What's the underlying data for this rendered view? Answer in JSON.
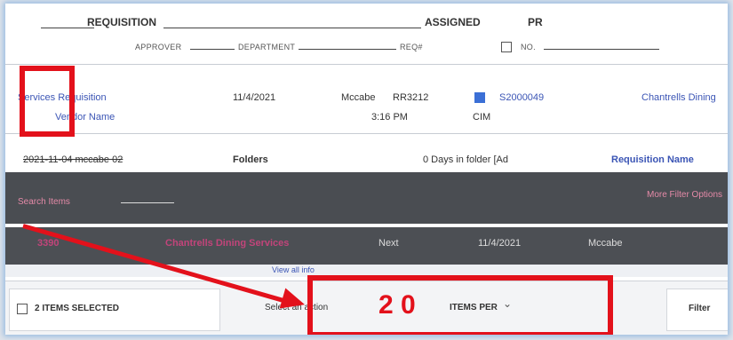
{
  "header": {
    "col_requisition": "REQUISITION",
    "col_assigned": "ASSIGNED",
    "col_pr": "PR",
    "sub_cols": [
      "APPROVER",
      "DEPARTMENT",
      "REQ#",
      "NO."
    ]
  },
  "rows": [
    {
      "name": "Services Requisition",
      "date": "11/4/2021",
      "user": "Mccabe",
      "pr_number": "RR3212",
      "vendor": "Vendor Name",
      "time": "3:16 PM",
      "amount": "S2000049",
      "status": "CIM",
      "org": "Chantrells Dining"
    },
    {
      "name": "2021-11-04 mccabe 02",
      "folder": "Folders",
      "days": "0 Days in folder [Ad",
      "req_name": "Requisition Name"
    }
  ],
  "band": {
    "left_text": "Search Items",
    "right_text": "More Filter Options"
  },
  "dark_row": {
    "id": "3390",
    "org": "Chantrells Dining Services",
    "col3": "Next",
    "date": "11/4/2021",
    "user": "Mccabe"
  },
  "light_row": {
    "text": "View all info"
  },
  "bottom_bar": {
    "items_selected": "2 ITEMS SELECTED",
    "select_action": "Select an action",
    "big_count": "2 0",
    "items_text": "ITEMS PER",
    "right_label": "Filter"
  },
  "colors": {
    "annotation_red": "#e3111b",
    "link_blue": "#3b55b5",
    "accent_pink": "#c2447a"
  }
}
